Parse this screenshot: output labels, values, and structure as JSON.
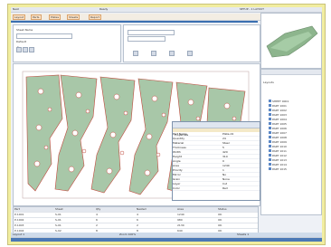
{
  "title_bar": {
    "app_title": "Nest",
    "right_text": "SETUP - 1 LAYOUT",
    "status_label": "Ready"
  },
  "tabs": [
    {
      "label": "Layout"
    },
    {
      "label": "Parts"
    },
    {
      "label": "Plates"
    },
    {
      "label": "Sheets"
    },
    {
      "label": "Report"
    }
  ],
  "left_panel": {
    "name_label": "Sheet Name",
    "value_label": "1",
    "option_label": "Default"
  },
  "properties": {
    "title": "Properties",
    "rows": [
      {
        "k": "Part Name",
        "v": "Plate-01"
      },
      {
        "k": "Quantity",
        "v": "24"
      },
      {
        "k": "Material",
        "v": "Steel"
      },
      {
        "k": "Thickness",
        "v": "5"
      },
      {
        "k": "Width",
        "v": "420"
      },
      {
        "k": "Height",
        "v": "310"
      },
      {
        "k": "Angle",
        "v": "0"
      },
      {
        "k": "Area",
        "v": "1240"
      },
      {
        "k": "Priority",
        "v": "1"
      },
      {
        "k": "Mirror",
        "v": "No"
      },
      {
        "k": "Grain",
        "v": "None"
      },
      {
        "k": "Layer",
        "v": "Cut"
      },
      {
        "k": "Color",
        "v": "Red"
      }
    ]
  },
  "tree": {
    "header": "Layouts",
    "items": [
      {
        "label": "SHEET 0001"
      },
      {
        "label": "PART 1001"
      },
      {
        "label": "PART 1002"
      },
      {
        "label": "PART 1003"
      },
      {
        "label": "PART 1004"
      },
      {
        "label": "PART 1005"
      },
      {
        "label": "PART 1006"
      },
      {
        "label": "PART 1007"
      },
      {
        "label": "PART 1008"
      },
      {
        "label": "PART 1009"
      },
      {
        "label": "PART 1010"
      },
      {
        "label": "PART 1011"
      },
      {
        "label": "PART 1012"
      },
      {
        "label": "PART 1013"
      },
      {
        "label": "PART 1014"
      },
      {
        "label": "PART 1015"
      }
    ]
  },
  "table": {
    "rows": [
      [
        "Part",
        "Sheet",
        "Qty",
        "Nested",
        "Area",
        "Status"
      ],
      [
        "P-1001",
        "S-01",
        "4",
        "4",
        "1240",
        "OK"
      ],
      [
        "P-1002",
        "S-01",
        "6",
        "6",
        "980",
        "OK"
      ],
      [
        "P-1003",
        "S-01",
        "2",
        "2",
        "2130",
        "OK"
      ],
      [
        "P-1004",
        "S-02",
        "8",
        "8",
        "640",
        "OK"
      ]
    ]
  },
  "footer": {
    "left_text": "Layout 1",
    "mid_text": "Zoom 100%",
    "right_text": "Sheets 1"
  },
  "colors": {
    "frame": "#f1eda0",
    "part_fill": "#a8c7a8",
    "part_stroke": "#c04a3d",
    "accent": "#3a6fb0"
  }
}
